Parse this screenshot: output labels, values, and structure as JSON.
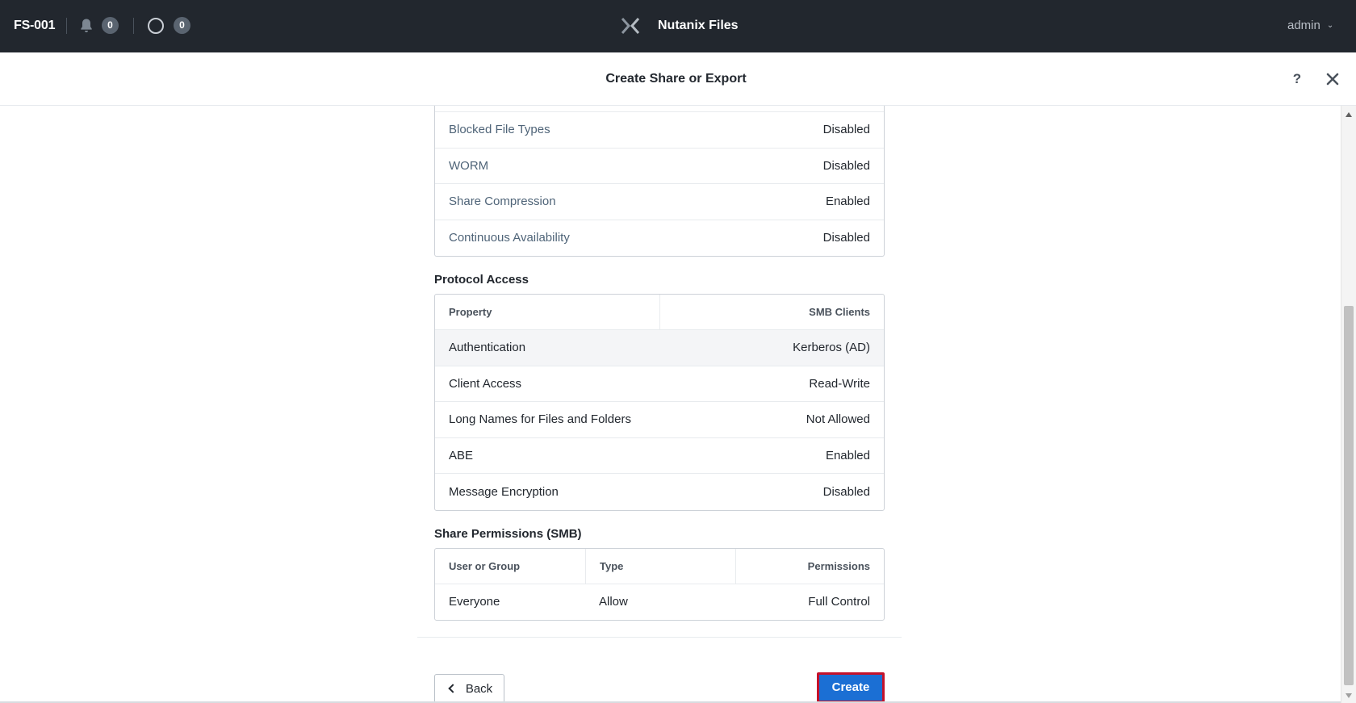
{
  "topbar": {
    "cluster_name": "FS-001",
    "alerts_count": "0",
    "tasks_count": "0",
    "app_title": "Nutanix Files",
    "user": "admin"
  },
  "modal": {
    "title": "Create Share or Export",
    "help_label": "?"
  },
  "general_settings": {
    "rows": [
      {
        "label": "Blocked File Types",
        "value": "Disabled"
      },
      {
        "label": "WORM",
        "value": "Disabled"
      },
      {
        "label": "Share Compression",
        "value": "Enabled"
      },
      {
        "label": "Continuous Availability",
        "value": "Disabled"
      }
    ]
  },
  "protocol_access": {
    "title": "Protocol Access",
    "headers": [
      "Property",
      "SMB Clients"
    ],
    "rows": [
      {
        "label": "Authentication",
        "value": "Kerberos (AD)"
      },
      {
        "label": "Client Access",
        "value": "Read-Write"
      },
      {
        "label": "Long Names for Files and Folders",
        "value": "Not Allowed"
      },
      {
        "label": "ABE",
        "value": "Enabled"
      },
      {
        "label": "Message Encryption",
        "value": "Disabled"
      }
    ]
  },
  "share_permissions": {
    "title": "Share Permissions (SMB)",
    "headers": [
      "User or Group",
      "Type",
      "Permissions"
    ],
    "rows": [
      {
        "user": "Everyone",
        "type": "Allow",
        "permissions": "Full Control"
      }
    ]
  },
  "footer": {
    "back_label": "Back",
    "create_label": "Create"
  }
}
